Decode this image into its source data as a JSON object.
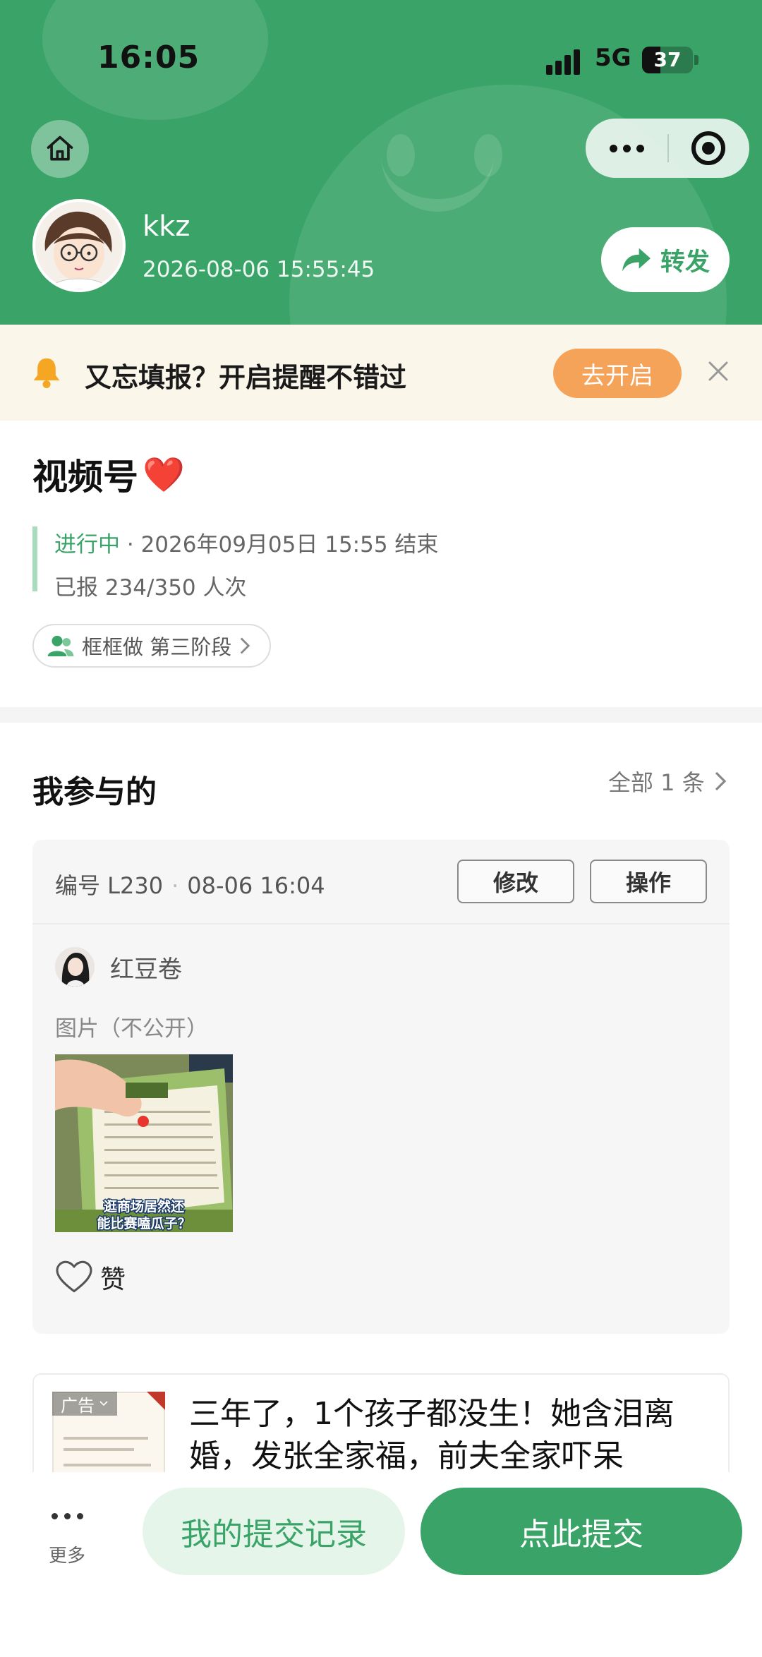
{
  "status_bar": {
    "time": "16:05",
    "network": "5G",
    "battery": "37"
  },
  "header": {
    "username": "kkz",
    "timestamp": "2026-08-06 15:55:45",
    "share_label": "转发",
    "accent_color": "#3aa468"
  },
  "reminder": {
    "text": "又忘填报？开启提醒不错过",
    "button_label": "去开启"
  },
  "activity": {
    "title": "视频号",
    "title_emoji": "❤️",
    "status": "进行中",
    "separator": "·",
    "end_text": "2026年09月05日 15:55 结束",
    "reported": "已报 234/350 人次",
    "stage_label": "框框做 第三阶段"
  },
  "participation": {
    "title": "我参与的",
    "all_label": "全部 1 条",
    "entry": {
      "number": "编号 L230",
      "time": "08-06 16:04",
      "edit_label": "修改",
      "action_label": "操作",
      "submitter": "红豆卷",
      "image_label": "图片（不公开）",
      "image_caption_line1": "逛商场居然还",
      "image_caption_line2": "能比赛嗑瓜子？",
      "like_label": "赞"
    }
  },
  "ad": {
    "tag": "广告",
    "text": "三年了，1个孩子都没生！她含泪离婚，发张全家福，前夫全家吓呆"
  },
  "bottom_bar": {
    "more_label": "更多",
    "records_label": "我的提交记录",
    "submit_label": "点此提交"
  }
}
